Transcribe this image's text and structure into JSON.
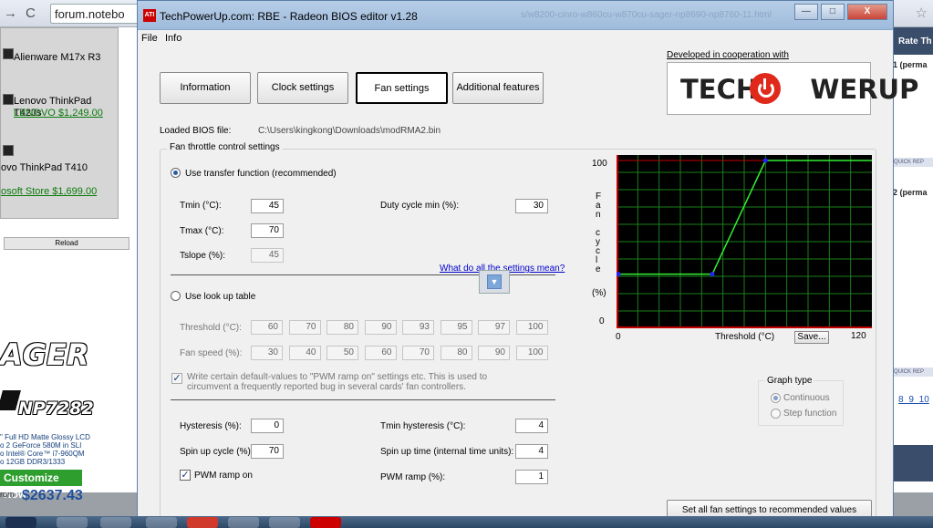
{
  "browser": {
    "url": "forum.notebo",
    "dropdown": [
      {
        "name": "Alienware M17x R3",
        "price": ""
      },
      {
        "name": "Lenovo ThinkPad T420s",
        "price": "LENOVO $1,249.00"
      },
      {
        "name": "ovo ThinkPad T410",
        "price": "osoft Store $1,699.00"
      }
    ],
    "reload": "Reload",
    "ad": {
      "brand": "AGER",
      "model": "NP7282",
      "specs": [
        "\" Full HD Matte Glossy LCD",
        "o 2 GeForce 580M in SLI",
        "o Intel® Core™ i7-960QM",
        "o 12GB DDR3/1333"
      ],
      "cta": "Customize Now",
      "from": "rom",
      "price": "$2637.43"
    },
    "right": {
      "header": "Rate Th",
      "item1": "1 (perma",
      "item2": "2 (perma",
      "quick": "QUICK REP",
      "pages": "8  9  10"
    }
  },
  "window": {
    "title": "TechPowerUp.com: RBE - Radeon BIOS editor v1.28",
    "ghost_url": "s/w8200-cinro-w860cu-w870cu-sager-np8690-np8760-11.html",
    "app_icon": "ATI",
    "menu": [
      "File",
      "Info"
    ],
    "controls": {
      "minimize": "—",
      "maximize": "□",
      "close": "X"
    }
  },
  "tabs": [
    {
      "label": "Information",
      "active": false
    },
    {
      "label": "Clock settings",
      "active": false
    },
    {
      "label": "Fan settings",
      "active": true
    },
    {
      "label": "Additional features",
      "active": false
    }
  ],
  "sponsor": {
    "coop": "Developed in cooperation with",
    "brand_left": "TECHP",
    "brand_right": "WERUP"
  },
  "bios": {
    "label": "Loaded BIOS file:",
    "path": "C:\\Users\\kingkong\\Downloads\\modRMA2.bin"
  },
  "fan": {
    "group_title": "Fan throttle control settings",
    "transfer_label": "Use transfer function (recommended)",
    "transfer_selected": true,
    "tmin_label": "Tmin (°C):",
    "tmin": "45",
    "tmax_label": "Tmax (°C):",
    "tmax": "70",
    "tslope_label": "Tslope (%):",
    "tslope": "45",
    "duty_label": "Duty cycle min (%):",
    "duty": "30",
    "help_link": "What do all the settings mean?",
    "lookup_label": "Use look up table",
    "threshold_label": "Threshold (°C):",
    "thresholds": [
      "60",
      "70",
      "80",
      "90",
      "93",
      "95",
      "97",
      "100"
    ],
    "speed_label": "Fan speed (%):",
    "speeds": [
      "30",
      "40",
      "50",
      "60",
      "70",
      "80",
      "90",
      "100"
    ],
    "pwm_default_text_1": "Write certain default-values to \"PWM ramp on\" settings etc. This is used to",
    "pwm_default_text_2": "circumvent a frequently reported bug in several cards' fan controllers.",
    "hysteresis_label": "Hysteresis (%):",
    "hysteresis": "0",
    "tmin_hyst_label": "Tmin hysteresis (°C):",
    "tmin_hyst": "4",
    "spinup_label": "Spin up cycle (%):",
    "spinup": "70",
    "spinup_time_label": "Spin up time (internal time units):",
    "spinup_time": "4",
    "pwm_on_label": "PWM ramp on",
    "pwm_ramp_label": "PWM ramp (%):",
    "pwm_ramp": "1",
    "reset_button": "Set all fan settings to recommended values"
  },
  "graph": {
    "y_max": "100",
    "y_min": "0",
    "x_min": "0",
    "x_max": "120",
    "y_title_chars": [
      "F",
      "a",
      "n",
      "",
      "c",
      "y",
      "c",
      "l",
      "e"
    ],
    "y_unit": "(%)",
    "x_title": "Threshold (°C)",
    "save": "Save...",
    "type_title": "Graph type",
    "continuous": "Continuous",
    "step": "Step function"
  },
  "chart_data": {
    "type": "line",
    "title": "",
    "xlabel": "Threshold (°C)",
    "ylabel": "Fan cycle (%)",
    "xlim": [
      0,
      120
    ],
    "ylim": [
      0,
      100
    ],
    "grid": true,
    "series": [
      {
        "x": [
          0,
          45,
          70,
          120
        ],
        "y": [
          30,
          30,
          100,
          100
        ]
      }
    ],
    "colors": {
      "background": "#000000",
      "grid": "#1a7f1a",
      "axis": "#c00000",
      "line": "#33ee33",
      "point": "#2222ff"
    }
  }
}
